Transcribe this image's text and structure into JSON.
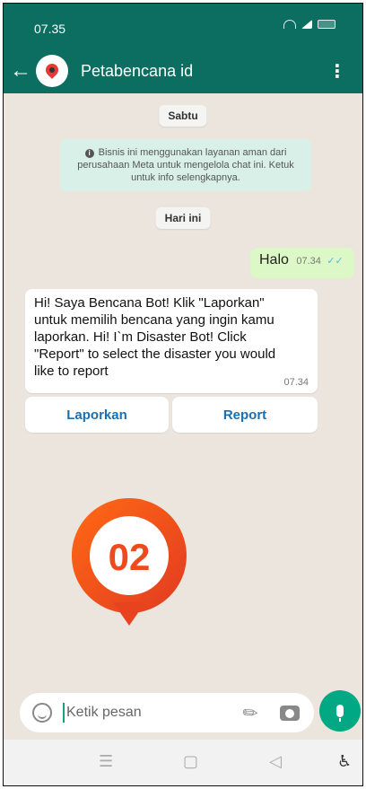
{
  "status_bar": {
    "time": "07.35"
  },
  "header": {
    "title": "Petabencana id"
  },
  "chat": {
    "date_day": "Sabtu",
    "notice": "Bisnis ini menggunakan layanan aman dari perusahaan Meta untuk mengelola chat ini. Ketuk untuk info selengkapnya.",
    "date_today": "Hari ini",
    "outgoing": {
      "text": "Halo",
      "time": "07.34"
    },
    "incoming": {
      "text": "Hi! Saya Bencana Bot! Klik \"Laporkan\" untuk memilih bencana yang ingin kamu laporkan. Hi! I`m Disaster Bot! Click \"Report\" to select the disaster you would like to report",
      "time": "07.34"
    },
    "quick_replies": [
      "Laporkan",
      "Report"
    ]
  },
  "badge": {
    "number": "02"
  },
  "composer": {
    "placeholder": "Ketik pesan"
  },
  "colors": {
    "header": "#0b6e60",
    "outgoing_bubble": "#dcf8c6",
    "notice_bg": "#d8f0e8",
    "mic": "#00a884",
    "badge": "#f04e23"
  }
}
